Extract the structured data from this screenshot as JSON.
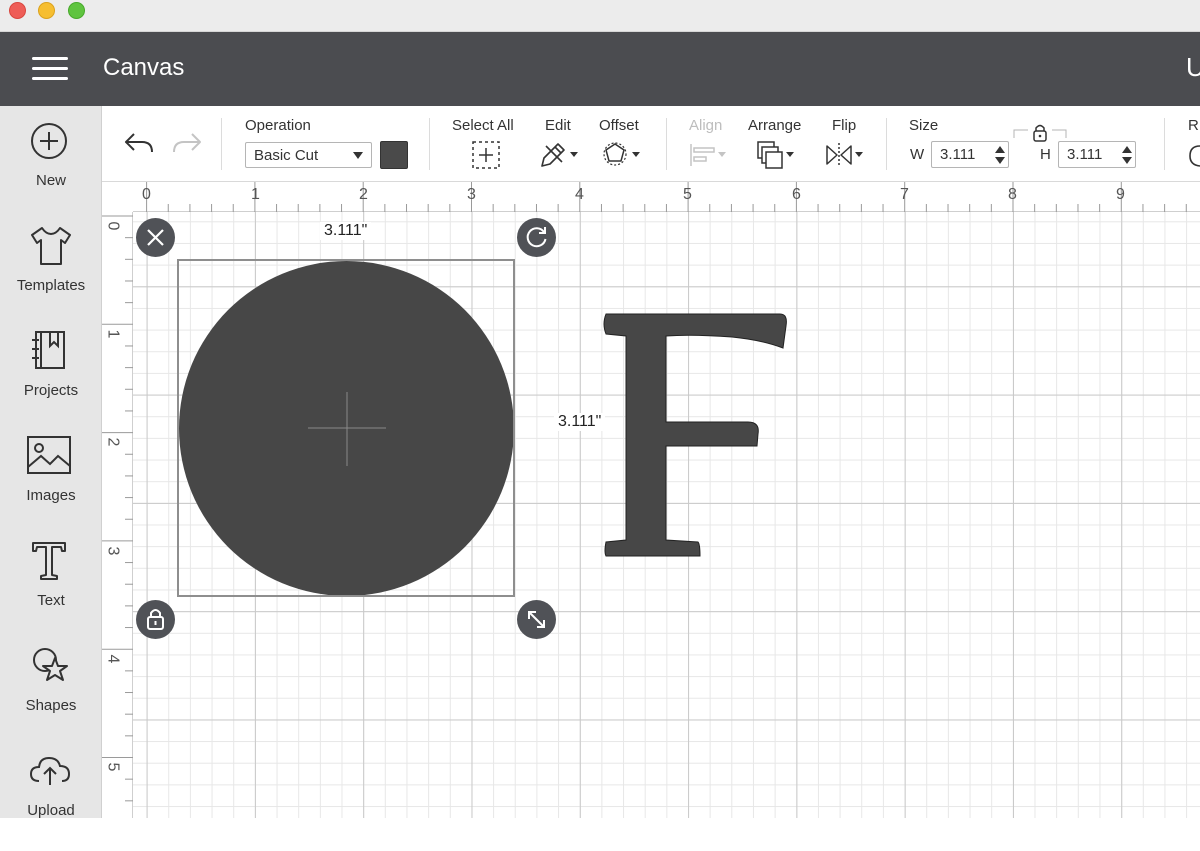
{
  "window": {
    "controls": [
      "close",
      "minimize",
      "zoom"
    ]
  },
  "header": {
    "title": "Canvas",
    "right_text_cut": "U"
  },
  "sidebar": {
    "items": [
      {
        "label": "New",
        "icon": "plus-circle-icon"
      },
      {
        "label": "Templates",
        "icon": "tshirt-icon"
      },
      {
        "label": "Projects",
        "icon": "notebook-icon"
      },
      {
        "label": "Images",
        "icon": "image-icon"
      },
      {
        "label": "Text",
        "icon": "text-t-icon"
      },
      {
        "label": "Shapes",
        "icon": "shapes-icon"
      },
      {
        "label": "Upload",
        "icon": "cloud-upload-icon"
      }
    ]
  },
  "toolbar": {
    "operation_label": "Operation",
    "operation_value": "Basic Cut",
    "operation_color": "#4a4a4a",
    "select_all_label": "Select All",
    "edit_label": "Edit",
    "offset_label": "Offset",
    "align_label": "Align",
    "arrange_label": "Arrange",
    "flip_label": "Flip",
    "size_label": "Size",
    "width_label": "W",
    "width_value": "3.111",
    "height_label": "H",
    "height_value": "3.111",
    "cut_label": "R"
  },
  "canvas": {
    "ruler_top": [
      "0",
      "1",
      "2",
      "3",
      "4",
      "5",
      "6",
      "7",
      "8",
      "9"
    ],
    "ruler_left": [
      "0",
      "1",
      "2",
      "3",
      "4",
      "5"
    ],
    "selection": {
      "width_text": "3.111\"",
      "height_text": "3.111\""
    },
    "objects": [
      {
        "type": "circle",
        "color": "#474747"
      },
      {
        "type": "text",
        "text": "F",
        "color": "#474747"
      }
    ]
  }
}
